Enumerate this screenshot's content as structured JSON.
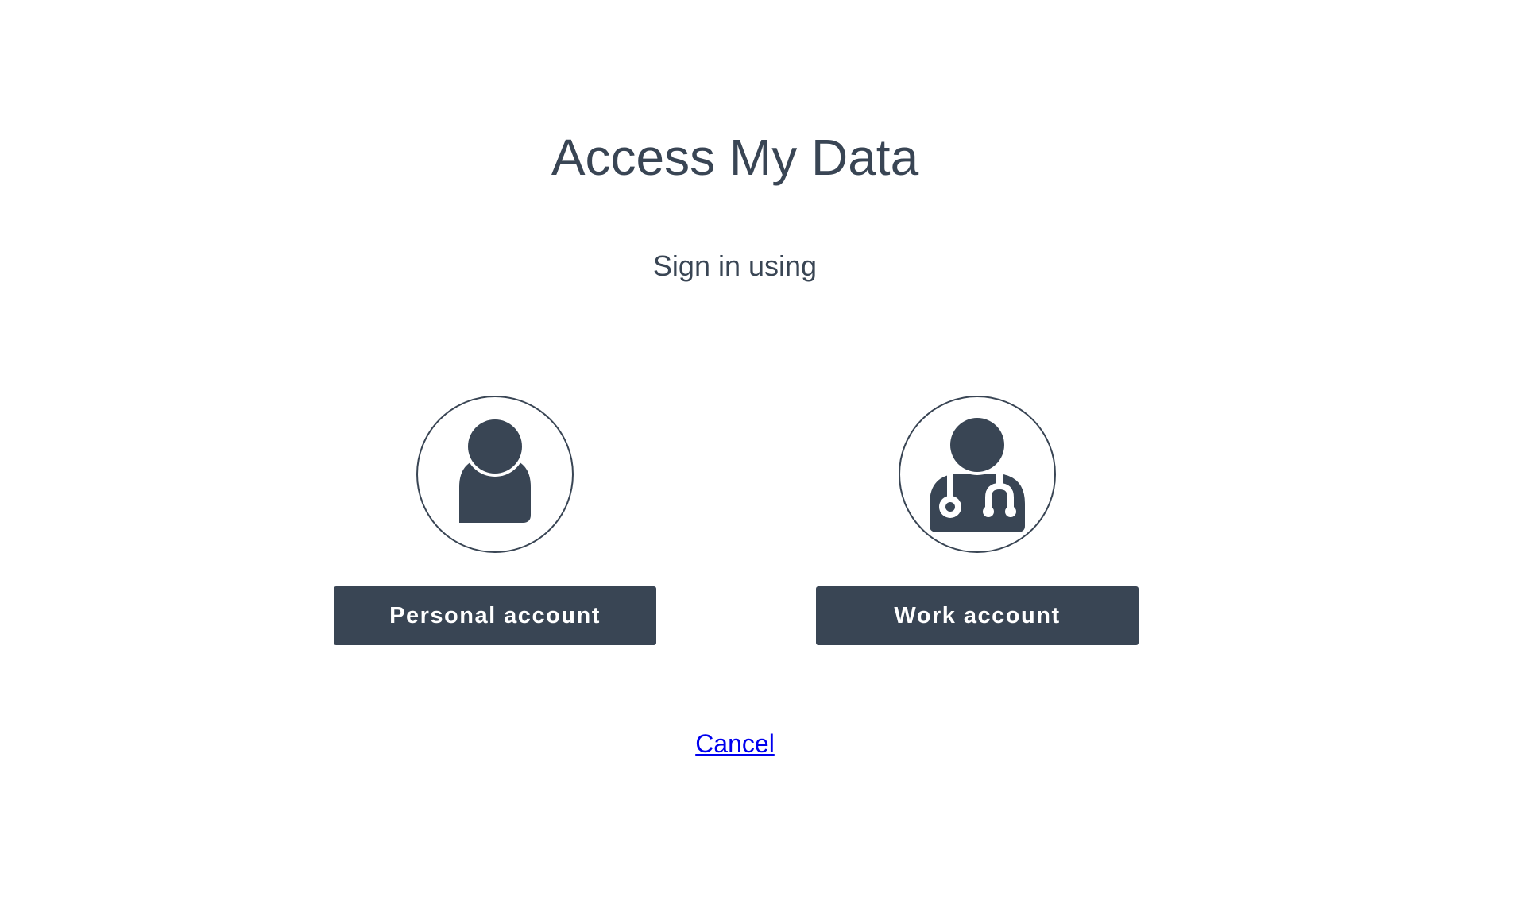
{
  "header": {
    "title": "Access My Data",
    "subtitle": "Sign in using"
  },
  "options": [
    {
      "icon": "person-icon",
      "label": "Personal account"
    },
    {
      "icon": "doctor-stethoscope-icon",
      "label": "Work account"
    }
  ],
  "footer": {
    "cancel_label": "Cancel"
  },
  "colors": {
    "primary": "#394554",
    "background": "#ffffff",
    "link": "#0000ee"
  }
}
